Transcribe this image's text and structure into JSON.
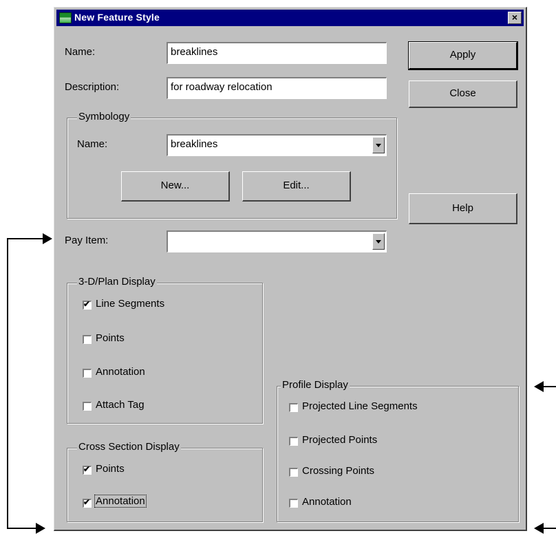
{
  "window": {
    "title": "New Feature Style",
    "close_glyph": "×"
  },
  "fields": {
    "name_label": "Name:",
    "name_value": "breaklines",
    "description_label": "Description:",
    "description_value": "for roadway relocation",
    "pay_item_label": "Pay Item:",
    "pay_item_value": ""
  },
  "buttons": {
    "apply": "Apply",
    "close": "Close",
    "help": "Help",
    "new": "New...",
    "edit": "Edit..."
  },
  "symbology": {
    "title": "Symbology",
    "name_label": "Name:",
    "name_value": "breaklines"
  },
  "plan_display": {
    "title": "3-D/Plan Display",
    "items": [
      {
        "label": "Line Segments",
        "checked": true
      },
      {
        "label": "Points",
        "checked": false
      },
      {
        "label": "Annotation",
        "checked": false
      },
      {
        "label": "Attach Tag",
        "checked": false
      }
    ]
  },
  "cross_section_display": {
    "title": "Cross Section Display",
    "items": [
      {
        "label": "Points",
        "checked": true
      },
      {
        "label": "Annotation",
        "checked": true
      }
    ]
  },
  "profile_display": {
    "title": "Profile Display",
    "items": [
      {
        "label": "Projected Line Segments",
        "checked": false
      },
      {
        "label": "Projected Points",
        "checked": false
      },
      {
        "label": "Crossing Points",
        "checked": false
      },
      {
        "label": "Annotation",
        "checked": false
      }
    ]
  },
  "icons": {
    "app": "map-terrain-icon",
    "dropdown": "dropdown-arrow-icon",
    "check": "checkmark-icon"
  },
  "colors": {
    "titlebar": "#000080",
    "dialog_bg": "#c0c0c0"
  }
}
